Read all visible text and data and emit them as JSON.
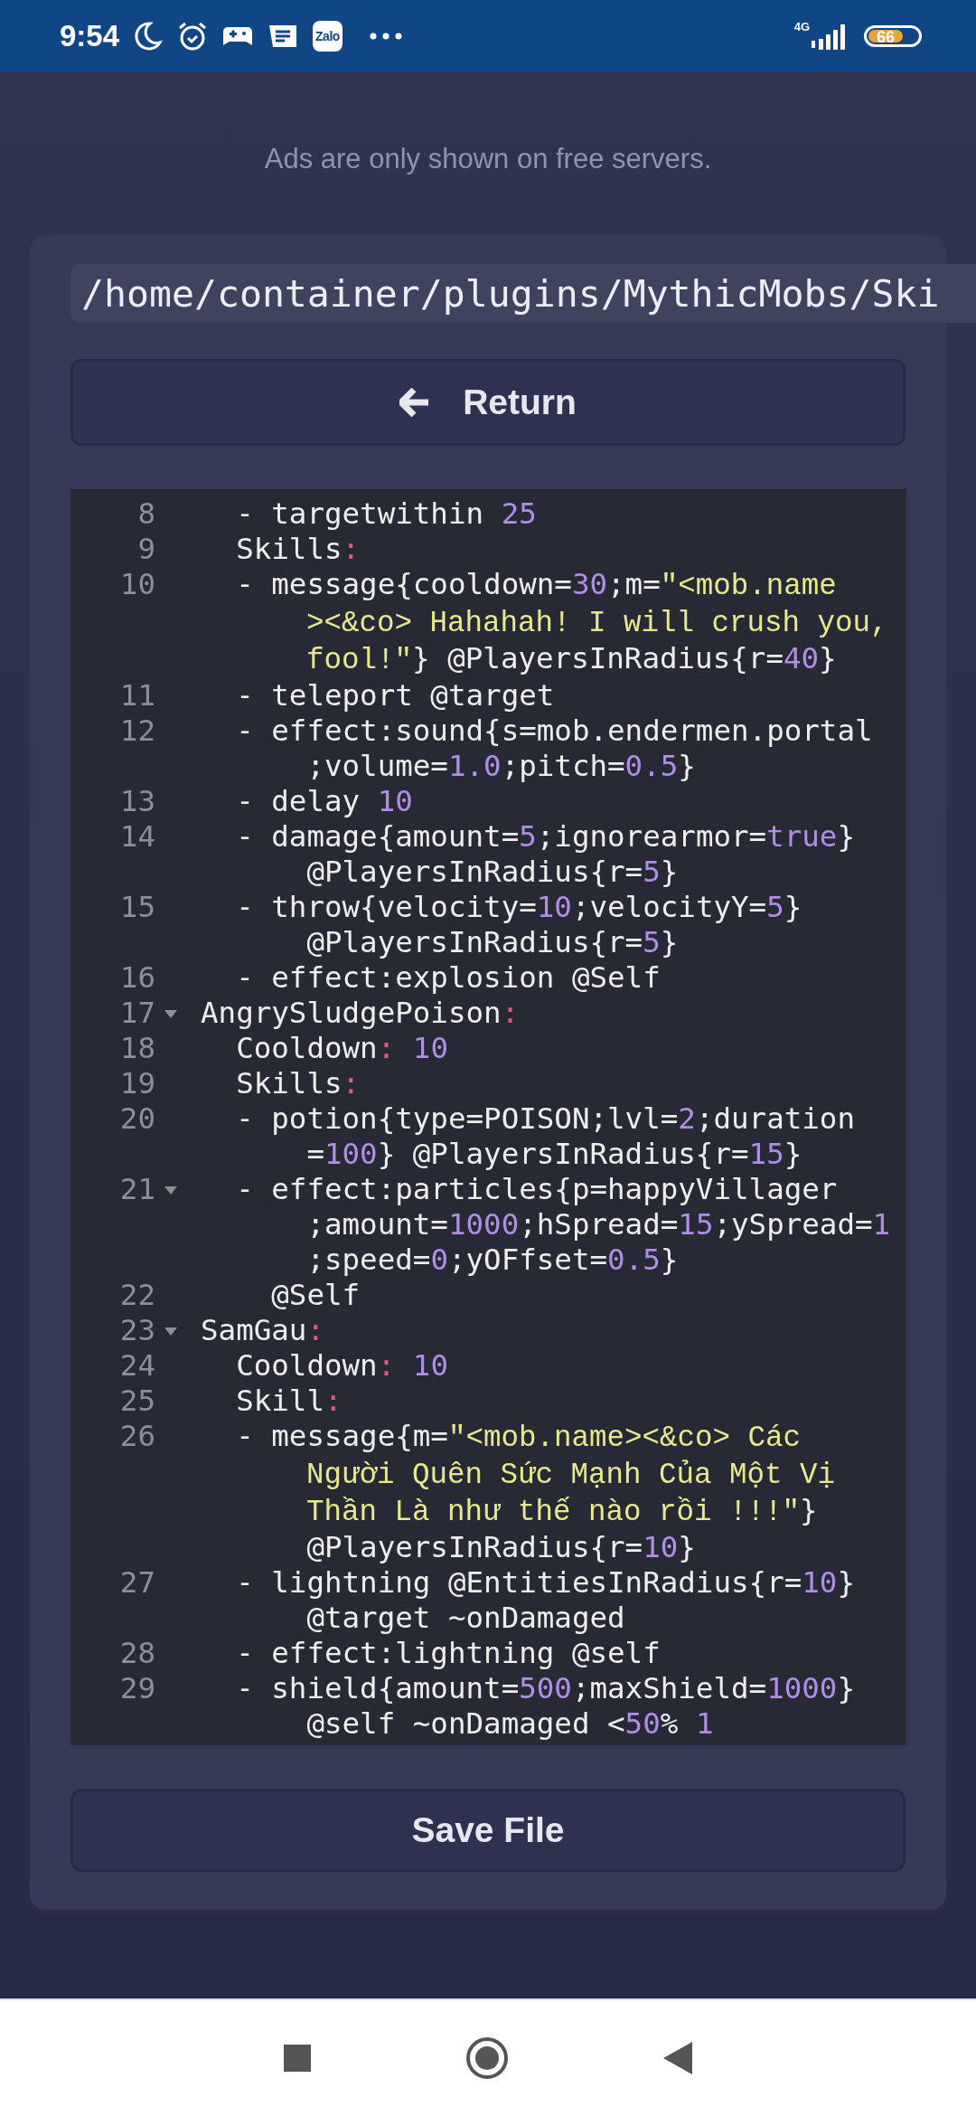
{
  "status_bar": {
    "time": "9:54",
    "zalo_label": "Zalo",
    "network": "4G",
    "battery": "66"
  },
  "ad_notice": "Ads are only shown on free servers.",
  "file_path": "/home/container/plugins/MythicMobs/Ski",
  "return_button": "Return",
  "code_lines": [
    {
      "number": "8",
      "fold": false,
      "wraps": [
        {
          "tokens": [
            {
              "kind": "plain",
              "text": "  - targetwithin "
            },
            {
              "kind": "number",
              "text": "25"
            }
          ]
        }
      ]
    },
    {
      "number": "9",
      "fold": false,
      "wraps": [
        {
          "tokens": [
            {
              "kind": "plain",
              "text": "  Skills"
            },
            {
              "kind": "colon",
              "text": ":"
            }
          ]
        }
      ]
    },
    {
      "number": "10",
      "fold": false,
      "wraps": [
        {
          "tokens": [
            {
              "kind": "plain",
              "text": "  - message{cooldown="
            },
            {
              "kind": "number",
              "text": "30"
            },
            {
              "kind": "plain",
              "text": ";m="
            },
            {
              "kind": "string",
              "text": "\"<mob.name"
            }
          ]
        },
        {
          "tokens": [
            {
              "kind": "string",
              "text": "      ><&co> Hahahah! I will crush you,"
            }
          ]
        },
        {
          "tokens": [
            {
              "kind": "string",
              "text": "      fool!\""
            },
            {
              "kind": "plain",
              "text": "} @PlayersInRadius{r="
            },
            {
              "kind": "number",
              "text": "40"
            },
            {
              "kind": "plain",
              "text": "}"
            }
          ]
        }
      ]
    },
    {
      "number": "11",
      "fold": false,
      "wraps": [
        {
          "tokens": [
            {
              "kind": "plain",
              "text": "  - teleport @target"
            }
          ]
        }
      ]
    },
    {
      "number": "12",
      "fold": false,
      "wraps": [
        {
          "tokens": [
            {
              "kind": "plain",
              "text": "  - effect:sound{s=mob.endermen.portal"
            }
          ]
        },
        {
          "tokens": [
            {
              "kind": "plain",
              "text": "      ;volume="
            },
            {
              "kind": "number",
              "text": "1.0"
            },
            {
              "kind": "plain",
              "text": ";pitch="
            },
            {
              "kind": "number",
              "text": "0.5"
            },
            {
              "kind": "plain",
              "text": "}"
            }
          ]
        }
      ]
    },
    {
      "number": "13",
      "fold": false,
      "wraps": [
        {
          "tokens": [
            {
              "kind": "plain",
              "text": "  - delay "
            },
            {
              "kind": "number",
              "text": "10"
            }
          ]
        }
      ]
    },
    {
      "number": "14",
      "fold": false,
      "wraps": [
        {
          "tokens": [
            {
              "kind": "plain",
              "text": "  - damage{amount="
            },
            {
              "kind": "number",
              "text": "5"
            },
            {
              "kind": "plain",
              "text": ";ignorearmor="
            },
            {
              "kind": "number",
              "text": "true"
            },
            {
              "kind": "plain",
              "text": "}"
            }
          ]
        },
        {
          "tokens": [
            {
              "kind": "plain",
              "text": "      @PlayersInRadius{r="
            },
            {
              "kind": "number",
              "text": "5"
            },
            {
              "kind": "plain",
              "text": "}"
            }
          ]
        }
      ]
    },
    {
      "number": "15",
      "fold": false,
      "wraps": [
        {
          "tokens": [
            {
              "kind": "plain",
              "text": "  - throw{velocity="
            },
            {
              "kind": "number",
              "text": "10"
            },
            {
              "kind": "plain",
              "text": ";velocityY="
            },
            {
              "kind": "number",
              "text": "5"
            },
            {
              "kind": "plain",
              "text": "}"
            }
          ]
        },
        {
          "tokens": [
            {
              "kind": "plain",
              "text": "      @PlayersInRadius{r="
            },
            {
              "kind": "number",
              "text": "5"
            },
            {
              "kind": "plain",
              "text": "}"
            }
          ]
        }
      ]
    },
    {
      "number": "16",
      "fold": false,
      "wraps": [
        {
          "tokens": [
            {
              "kind": "plain",
              "text": "  - effect:explosion @Self"
            }
          ]
        }
      ]
    },
    {
      "number": "17",
      "fold": true,
      "wraps": [
        {
          "tokens": [
            {
              "kind": "plain",
              "text": "AngrySludgePoison"
            },
            {
              "kind": "colon",
              "text": ":"
            }
          ]
        }
      ]
    },
    {
      "number": "18",
      "fold": false,
      "wraps": [
        {
          "tokens": [
            {
              "kind": "plain",
              "text": "  Cooldown"
            },
            {
              "kind": "colon",
              "text": ":"
            },
            {
              "kind": "number",
              "text": " 10"
            }
          ]
        }
      ]
    },
    {
      "number": "19",
      "fold": false,
      "wraps": [
        {
          "tokens": [
            {
              "kind": "plain",
              "text": "  Skills"
            },
            {
              "kind": "colon",
              "text": ":"
            }
          ]
        }
      ]
    },
    {
      "number": "20",
      "fold": false,
      "wraps": [
        {
          "tokens": [
            {
              "kind": "plain",
              "text": "  - potion{type=POISON;lvl="
            },
            {
              "kind": "number",
              "text": "2"
            },
            {
              "kind": "plain",
              "text": ";duration"
            }
          ]
        },
        {
          "tokens": [
            {
              "kind": "plain",
              "text": "      ="
            },
            {
              "kind": "number",
              "text": "100"
            },
            {
              "kind": "plain",
              "text": "} @PlayersInRadius{r="
            },
            {
              "kind": "number",
              "text": "15"
            },
            {
              "kind": "plain",
              "text": "}"
            }
          ]
        }
      ]
    },
    {
      "number": "21",
      "fold": true,
      "wraps": [
        {
          "tokens": [
            {
              "kind": "plain",
              "text": "  - effect:particles{p=happyVillager"
            }
          ]
        },
        {
          "tokens": [
            {
              "kind": "plain",
              "text": "      ;amount="
            },
            {
              "kind": "number",
              "text": "1000"
            },
            {
              "kind": "plain",
              "text": ";hSpread="
            },
            {
              "kind": "number",
              "text": "15"
            },
            {
              "kind": "plain",
              "text": ";ySpread="
            },
            {
              "kind": "number",
              "text": "1"
            }
          ]
        },
        {
          "tokens": [
            {
              "kind": "plain",
              "text": "      ;speed="
            },
            {
              "kind": "number",
              "text": "0"
            },
            {
              "kind": "plain",
              "text": ";yOFfset="
            },
            {
              "kind": "number",
              "text": "0.5"
            },
            {
              "kind": "plain",
              "text": "}"
            }
          ]
        }
      ]
    },
    {
      "number": "22",
      "fold": false,
      "wraps": [
        {
          "tokens": [
            {
              "kind": "plain",
              "text": "    @Self"
            }
          ]
        }
      ]
    },
    {
      "number": "23",
      "fold": true,
      "wraps": [
        {
          "tokens": [
            {
              "kind": "plain",
              "text": "SamGau"
            },
            {
              "kind": "colon",
              "text": ":"
            }
          ]
        }
      ]
    },
    {
      "number": "24",
      "fold": false,
      "wraps": [
        {
          "tokens": [
            {
              "kind": "plain",
              "text": "  Cooldown"
            },
            {
              "kind": "colon",
              "text": ":"
            },
            {
              "kind": "number",
              "text": " 10"
            }
          ]
        }
      ]
    },
    {
      "number": "25",
      "fold": false,
      "wraps": [
        {
          "tokens": [
            {
              "kind": "plain",
              "text": "  Skill"
            },
            {
              "kind": "colon",
              "text": ":"
            }
          ]
        }
      ]
    },
    {
      "number": "26",
      "fold": false,
      "wraps": [
        {
          "tokens": [
            {
              "kind": "plain",
              "text": "  - message{m="
            },
            {
              "kind": "string",
              "text": "\"<mob.name><&co> Các"
            }
          ]
        },
        {
          "tokens": [
            {
              "kind": "string",
              "text": "      Người Quên Sức Mạnh Của Một Vị"
            }
          ]
        },
        {
          "tokens": [
            {
              "kind": "string",
              "text": "      Thần Là như thế nào rồi !!!\""
            },
            {
              "kind": "plain",
              "text": "}"
            }
          ]
        },
        {
          "tokens": [
            {
              "kind": "plain",
              "text": "      @PlayersInRadius{r="
            },
            {
              "kind": "number",
              "text": "10"
            },
            {
              "kind": "plain",
              "text": "}"
            }
          ]
        }
      ]
    },
    {
      "number": "27",
      "fold": false,
      "wraps": [
        {
          "tokens": [
            {
              "kind": "plain",
              "text": "  - lightning @EntitiesInRadius{r="
            },
            {
              "kind": "number",
              "text": "10"
            },
            {
              "kind": "plain",
              "text": "}"
            }
          ]
        },
        {
          "tokens": [
            {
              "kind": "plain",
              "text": "      @target ~onDamaged"
            }
          ]
        }
      ]
    },
    {
      "number": "28",
      "fold": false,
      "wraps": [
        {
          "tokens": [
            {
              "kind": "plain",
              "text": "  - effect:lightning @self"
            }
          ]
        }
      ]
    },
    {
      "number": "29",
      "fold": false,
      "wraps": [
        {
          "tokens": [
            {
              "kind": "plain",
              "text": "  - shield{amount="
            },
            {
              "kind": "number",
              "text": "500"
            },
            {
              "kind": "plain",
              "text": ";maxShield="
            },
            {
              "kind": "number",
              "text": "1000"
            },
            {
              "kind": "plain",
              "text": "}"
            }
          ]
        },
        {
          "tokens": [
            {
              "kind": "plain",
              "text": "      @self ~onDamaged <"
            },
            {
              "kind": "number",
              "text": "50"
            },
            {
              "kind": "plain",
              "text": "% "
            },
            {
              "kind": "number",
              "text": "1"
            }
          ]
        }
      ]
    }
  ],
  "save_button": "Save File"
}
